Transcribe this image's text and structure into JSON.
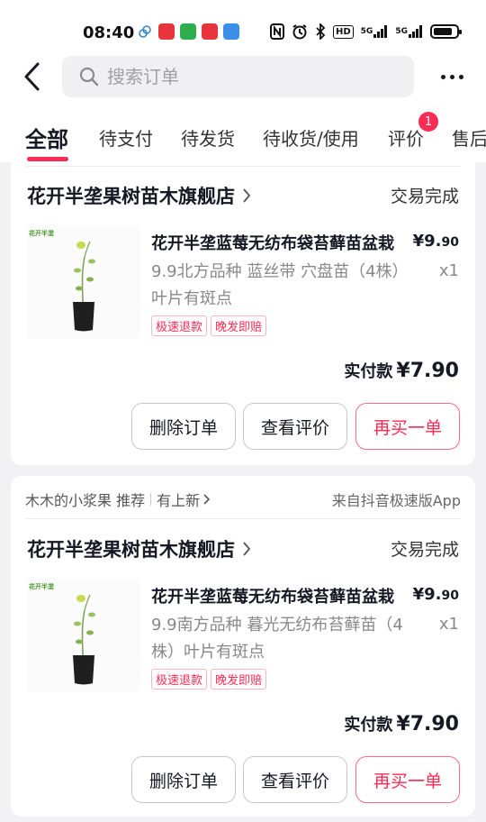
{
  "status_bar": {
    "time": "08:40",
    "icons": [
      "nfc-icon",
      "alarm-icon",
      "bluetooth-icon",
      "hd-icon",
      "5g-signal-icon",
      "5g-signal-icon",
      "battery-icon"
    ],
    "hd_label": "HD",
    "signal1": "5G",
    "signal2": "5G"
  },
  "header": {
    "search_placeholder": "搜索订单"
  },
  "tabs": [
    {
      "label": "全部",
      "active": true
    },
    {
      "label": "待支付"
    },
    {
      "label": "待发货"
    },
    {
      "label": "待收货/使用"
    },
    {
      "label": "评价",
      "badge": "1"
    },
    {
      "label": "售后"
    }
  ],
  "orders": [
    {
      "shop": "花开半垄果树苗木旗舰店",
      "status": "交易完成",
      "title": "花开半垄蓝莓无纺布袋苔藓苗盆栽",
      "price_main": "¥9.",
      "price_dec": "90",
      "spec": "9.9北方品种 蓝丝带 穴盘苗（4株）叶片有斑点",
      "qty": "x1",
      "tags": [
        "极速退款",
        "晚发即赔"
      ],
      "paid_label": "实付款",
      "paid_amount": "¥7.90",
      "buttons": [
        "删除订单",
        "查看评价",
        "再买一单"
      ]
    },
    {
      "source_left": "木木的小浆果 推荐",
      "source_mid": "有上新",
      "source_right": "来自抖音极速版App",
      "shop": "花开半垄果树苗木旗舰店",
      "status": "交易完成",
      "title": "花开半垄蓝莓无纺布袋苔藓苗盆栽",
      "price_main": "¥9.",
      "price_dec": "90",
      "spec": "9.9南方品种 暮光无纺布苔藓苗（4株）叶片有斑点",
      "qty": "x1",
      "tags": [
        "极速退款",
        "晚发即赔"
      ],
      "paid_label": "实付款",
      "paid_amount": "¥7.90",
      "buttons": [
        "删除订单",
        "查看评价",
        "再买一单"
      ]
    }
  ],
  "colors": {
    "accent": "#fe2c55",
    "background": "#f2f2f5"
  }
}
